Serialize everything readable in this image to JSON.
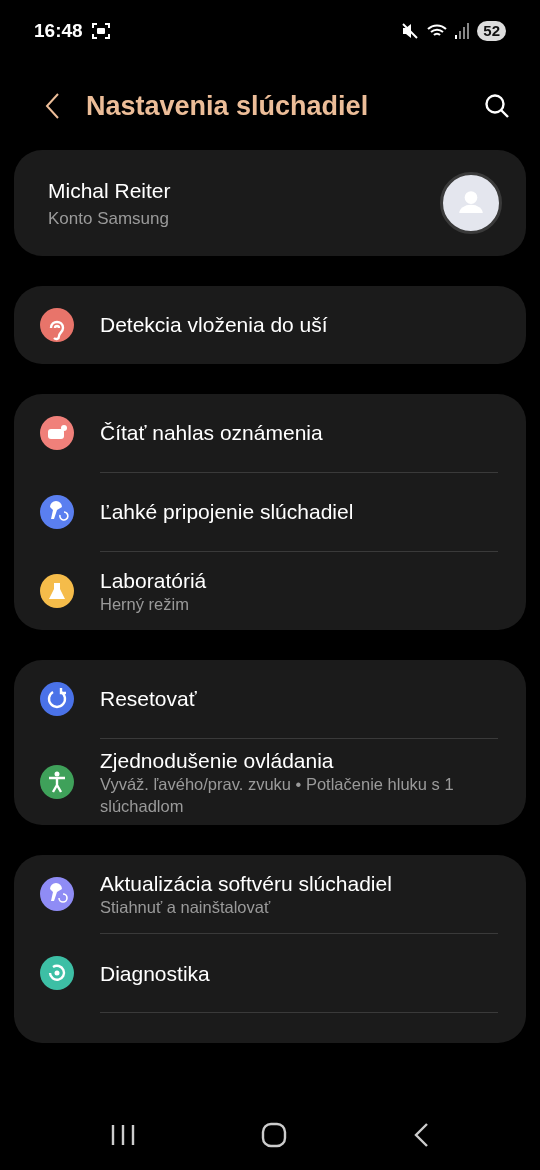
{
  "status_bar": {
    "time": "16:48",
    "battery": "52"
  },
  "header": {
    "title": "Nastavenia slúchadiel"
  },
  "account": {
    "name": "Michal Reiter",
    "subtitle": "Konto Samsung"
  },
  "groups": [
    {
      "items": [
        {
          "title": "Detekcia vloženia do uší",
          "color": "#e8746a"
        }
      ]
    },
    {
      "items": [
        {
          "title": "Čítať nahlas oznámenia",
          "color": "#f0807a"
        },
        {
          "title": "Ľahké pripojenie slúchadiel",
          "color": "#5a7ff0"
        },
        {
          "title": "Laboratóriá",
          "subtitle": "Herný režim",
          "color": "#f5bc4a"
        }
      ]
    },
    {
      "items": [
        {
          "title": "Resetovať",
          "color": "#4a72e8"
        },
        {
          "title": "Zjednodušenie ovládania",
          "subtitle": "Vyváž. ľavého/prav. zvuku • Potlačenie hluku s 1 slúchadlom",
          "color": "#3fa15a"
        }
      ]
    },
    {
      "items": [
        {
          "title": "Aktualizácia softvéru slúchadiel",
          "subtitle": "Stiahnuť a nainštalovať",
          "color": "#8f8cf5"
        },
        {
          "title": "Diagnostika",
          "color": "#3dbfa5"
        }
      ]
    }
  ]
}
